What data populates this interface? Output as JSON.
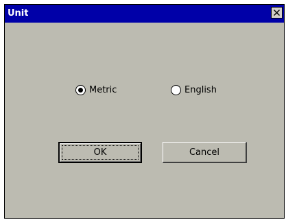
{
  "dialog": {
    "title": "Unit",
    "close_glyph": "✕",
    "colors": {
      "titlebar": "#0000a8",
      "face": "#bcbbb1"
    }
  },
  "unit_options": [
    {
      "label": "Metric",
      "selected": true
    },
    {
      "label": "English",
      "selected": false
    }
  ],
  "buttons": {
    "ok": "OK",
    "cancel": "Cancel"
  }
}
